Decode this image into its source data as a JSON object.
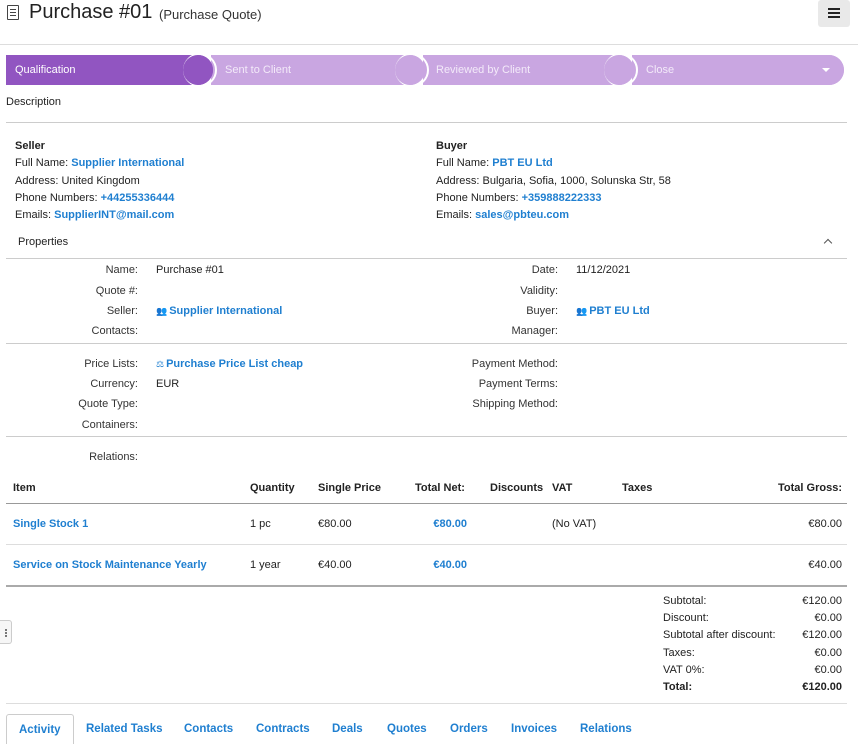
{
  "header": {
    "title": "Purchase #01",
    "subtitle": "(Purchase Quote)"
  },
  "stages": [
    {
      "label": "Qualification",
      "state": "active"
    },
    {
      "label": "Sent to Client",
      "state": "future"
    },
    {
      "label": "Reviewed by Client",
      "state": "future"
    },
    {
      "label": "Close",
      "state": "future"
    }
  ],
  "description_label": "Description",
  "seller": {
    "heading": "Seller",
    "full_name_label": "Full Name:",
    "full_name": "Supplier International",
    "address_label": "Address:",
    "address": "United Kingdom",
    "phone_label": "Phone Numbers:",
    "phone": "+44255336444",
    "emails_label": "Emails:",
    "email": "SupplierINT@mail.com"
  },
  "buyer": {
    "heading": "Buyer",
    "full_name_label": "Full Name:",
    "full_name": "PBT EU Ltd",
    "address_label": "Address:",
    "address": "Bulgaria, Sofia, 1000, Solunska Str, 58",
    "phone_label": "Phone Numbers:",
    "phone": "+359888222333",
    "emails_label": "Emails:",
    "email": "sales@pbteu.com"
  },
  "properties": {
    "heading": "Properties",
    "left": [
      {
        "label": "Name:",
        "value": "Purchase #01"
      },
      {
        "label": "Quote #:",
        "value": ""
      },
      {
        "label": "Seller:",
        "value": "Supplier International"
      },
      {
        "label": "Contacts:",
        "value": ""
      }
    ],
    "right": [
      {
        "label": "Date:",
        "value": "11/12/2021"
      },
      {
        "label": "Validity:",
        "value": ""
      },
      {
        "label": "Buyer:",
        "value": "PBT EU Ltd"
      },
      {
        "label": "Manager:",
        "value": ""
      }
    ],
    "left2": [
      {
        "label": "Price Lists:",
        "value": "Purchase Price List cheap"
      },
      {
        "label": "Currency:",
        "value": "EUR"
      },
      {
        "label": "Quote Type:",
        "value": ""
      },
      {
        "label": "Containers:",
        "value": ""
      }
    ],
    "right2": [
      {
        "label": "Payment Method:",
        "value": ""
      },
      {
        "label": "Payment Terms:",
        "value": ""
      },
      {
        "label": "Shipping Method:",
        "value": ""
      }
    ],
    "relations_label": "Relations:"
  },
  "table": {
    "headers": [
      "Item",
      "Quantity",
      "Single Price",
      "Total Net:",
      "Discounts",
      "VAT",
      "Taxes",
      "Total Gross:"
    ],
    "rows": [
      {
        "item": "Single Stock 1",
        "quantity": "1 pc",
        "single_price": "€80.00",
        "total_net": "€80.00",
        "discounts": "",
        "vat": "(No VAT)",
        "taxes": "",
        "total_gross": "€80.00"
      },
      {
        "item": "Service on Stock Maintenance Yearly",
        "quantity": "1 year",
        "single_price": "€40.00",
        "total_net": "€40.00",
        "discounts": "",
        "vat": "",
        "taxes": "",
        "total_gross": "€40.00"
      }
    ]
  },
  "totals": [
    {
      "label": "Subtotal:",
      "value": "€120.00"
    },
    {
      "label": "Discount:",
      "value": "€0.00"
    },
    {
      "label": "Subtotal after discount:",
      "value": "€120.00"
    },
    {
      "label": "Taxes:",
      "value": "€0.00"
    },
    {
      "label": "VAT 0%:",
      "value": "€0.00"
    },
    {
      "label": "Total:",
      "value": "€120.00"
    }
  ],
  "tabs": [
    "Activity",
    "Related Tasks",
    "Contacts",
    "Contracts",
    "Deals",
    "Quotes",
    "Orders",
    "Invoices",
    "Relations"
  ],
  "colors": {
    "stage_active": "#9155c1",
    "stage_future": "#c9a6e1",
    "link": "#1f7fd0"
  }
}
